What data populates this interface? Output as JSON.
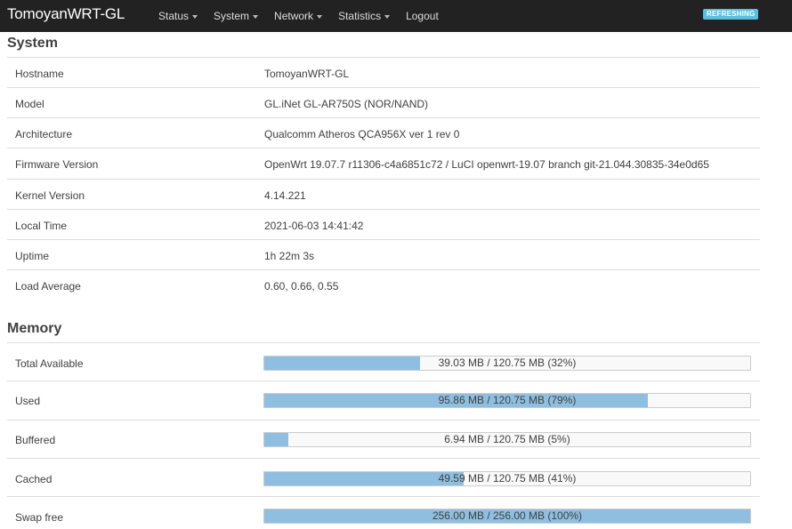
{
  "navbar": {
    "brand": "TomoyanWRT-GL",
    "menu": [
      "Status",
      "System",
      "Network",
      "Statistics",
      "Logout"
    ],
    "badge": "REFRESHING"
  },
  "system": {
    "title": "System",
    "rows": [
      {
        "label": "Hostname",
        "value": "TomoyanWRT-GL"
      },
      {
        "label": "Model",
        "value": "GL.iNet GL-AR750S (NOR/NAND)"
      },
      {
        "label": "Architecture",
        "value": "Qualcomm Atheros QCA956X ver 1 rev 0"
      },
      {
        "label": "Firmware Version",
        "value": "OpenWrt 19.07.7 r11306-c4a6851c72 / LuCI openwrt-19.07 branch git-21.044.30835-34e0d65"
      },
      {
        "label": "Kernel Version",
        "value": "4.14.221"
      },
      {
        "label": "Local Time",
        "value": "2021-06-03 14:41:42"
      },
      {
        "label": "Uptime",
        "value": "1h 22m 3s"
      },
      {
        "label": "Load Average",
        "value": "0.60, 0.66, 0.55"
      }
    ]
  },
  "memory": {
    "title": "Memory",
    "rows": [
      {
        "label": "Total Available",
        "text": "39.03 MB / 120.75 MB (32%)",
        "percent": 32
      },
      {
        "label": "Used",
        "text": "95.86 MB / 120.75 MB (79%)",
        "percent": 79
      },
      {
        "label": "Buffered",
        "text": "6.94 MB / 120.75 MB (5%)",
        "percent": 5
      },
      {
        "label": "Cached",
        "text": "49.59 MB / 120.75 MB (41%)",
        "percent": 41
      },
      {
        "label": "Swap free",
        "text": "256.00 MB / 256.00 MB (100%)",
        "percent": 100
      }
    ]
  }
}
